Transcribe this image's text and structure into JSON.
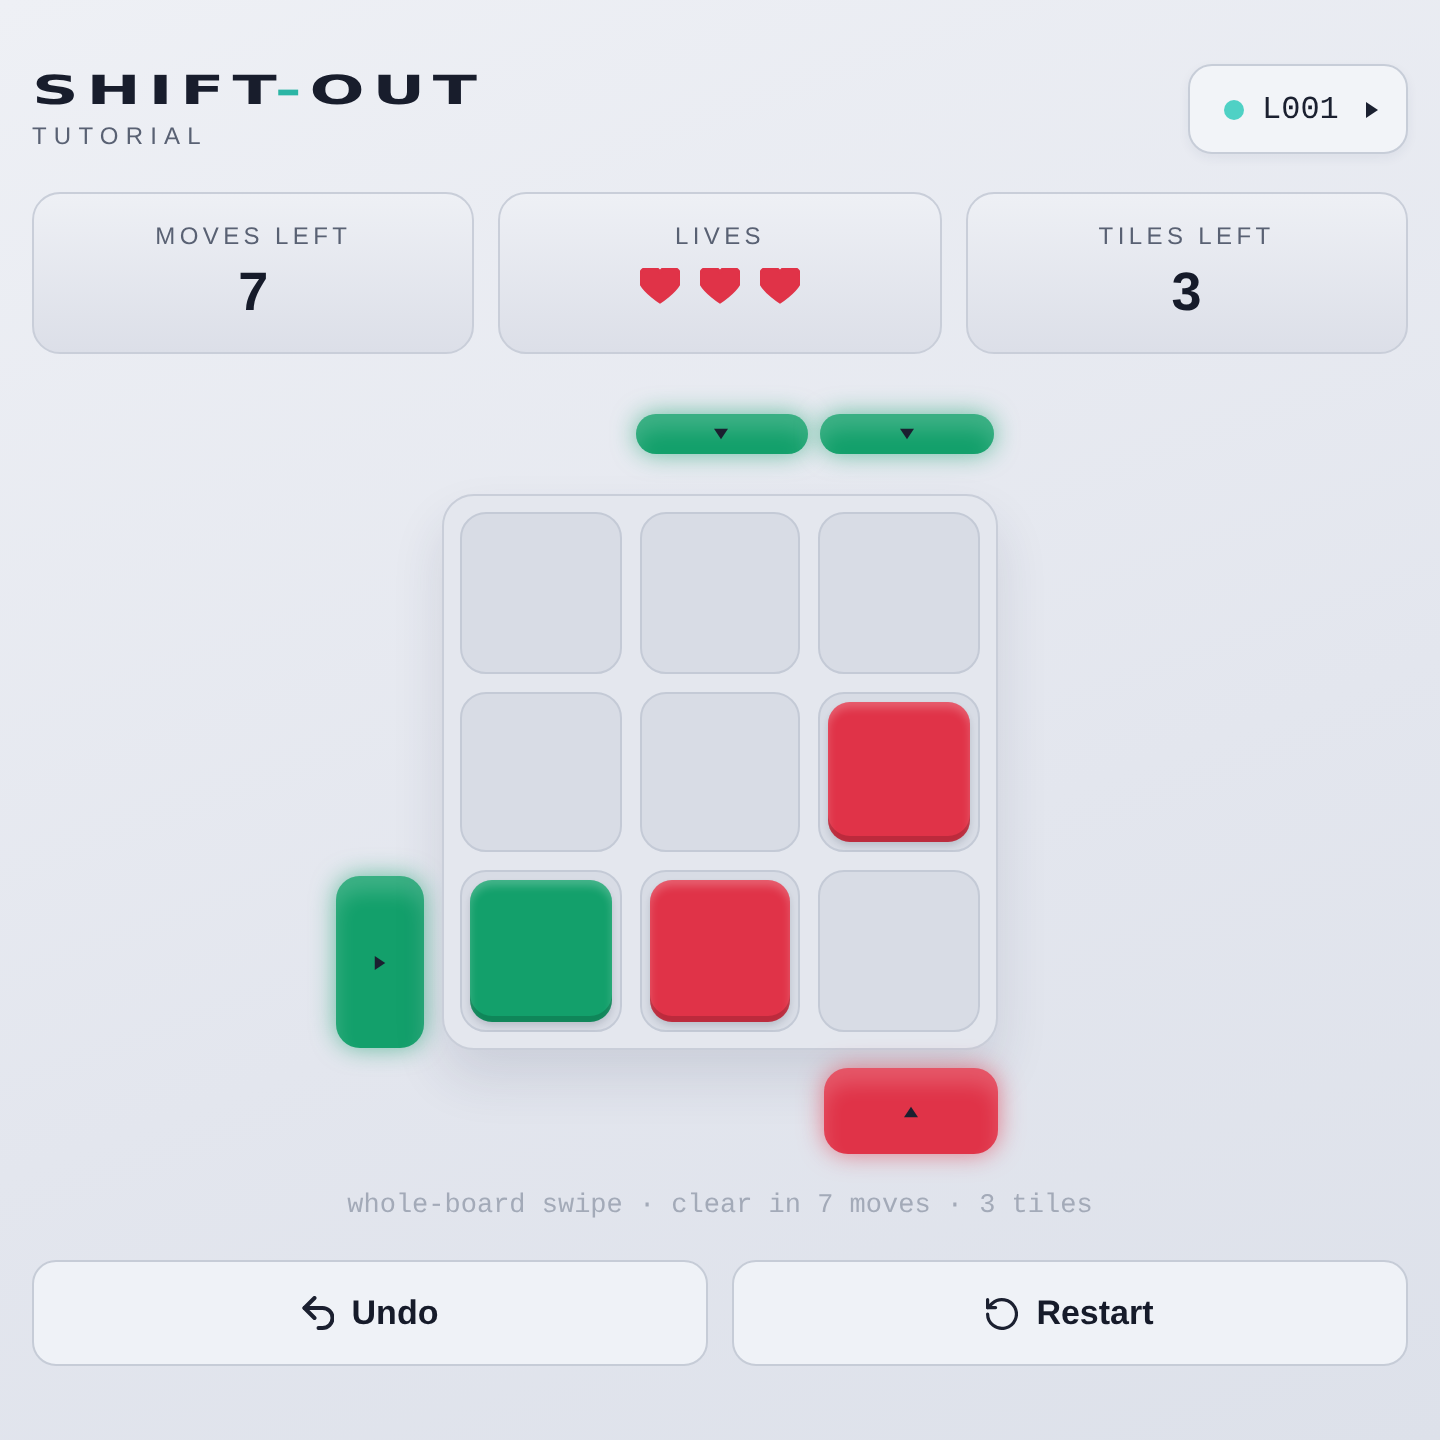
{
  "header": {
    "title": {
      "before": "SHIFT",
      "separator": "-",
      "after": "OUT"
    },
    "subtitle": "TUTORIAL",
    "level_button": {
      "label": "L001"
    }
  },
  "stats": [
    {
      "kind": "number",
      "label": "MOVES LEFT",
      "value": "7"
    },
    {
      "kind": "hearts",
      "label": "LIVES",
      "hearts": [
        {
          "filled": true
        },
        {
          "filled": true
        },
        {
          "filled": true
        }
      ]
    },
    {
      "kind": "number",
      "label": "TILES LEFT",
      "value": "3"
    }
  ],
  "board": {
    "top_gates": [
      {
        "kind": "none"
      },
      {
        "kind": "gate",
        "color": "#13a06b",
        "thick": false
      },
      {
        "kind": "gate",
        "color": "#13a06b",
        "thick": false
      }
    ],
    "left_gates": [
      {
        "kind": "none"
      },
      {
        "kind": "none"
      },
      {
        "kind": "gate",
        "color": "#13a06b",
        "thick": true
      }
    ],
    "bottom_gates": [
      {
        "kind": "none"
      },
      {
        "kind": "none"
      },
      {
        "kind": "gate",
        "color": "#e03348",
        "thick": true
      }
    ],
    "rows": [
      [
        {
          "kind": "empty"
        },
        {
          "kind": "empty"
        },
        {
          "kind": "empty"
        }
      ],
      [
        {
          "kind": "empty"
        },
        {
          "kind": "empty"
        },
        {
          "kind": "tile",
          "color": "#e03348"
        }
      ],
      [
        {
          "kind": "tile",
          "color": "#13a06b"
        },
        {
          "kind": "tile",
          "color": "#e03348"
        },
        {
          "kind": "empty"
        }
      ]
    ]
  },
  "hint": "whole-board swipe · clear in 7 moves · 3 tiles",
  "buttons": [
    {
      "kind": "undo",
      "label": "Undo"
    },
    {
      "kind": "restart",
      "label": "Restart"
    }
  ]
}
